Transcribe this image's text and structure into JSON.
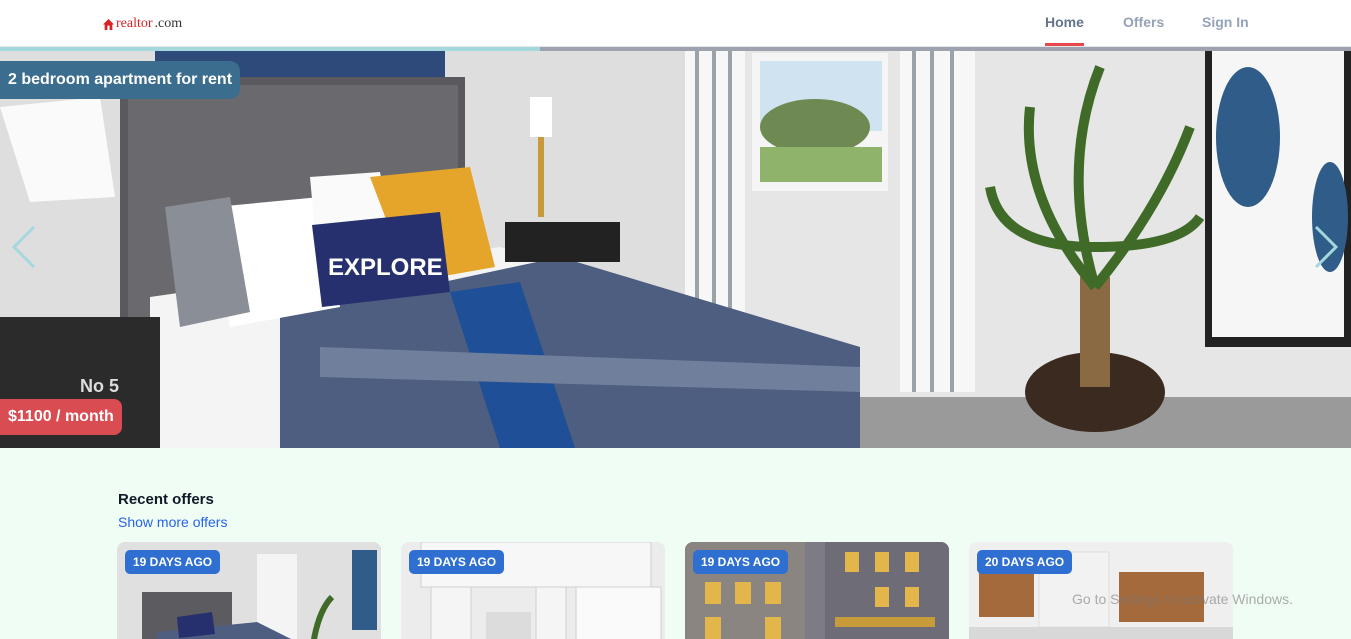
{
  "header": {
    "logo_text": "realtor",
    "logo_tld": ".com",
    "nav": [
      {
        "label": "Home",
        "active": true
      },
      {
        "label": "Offers",
        "active": false
      },
      {
        "label": "Sign In",
        "active": false
      }
    ]
  },
  "hero": {
    "title": "2 bedroom apartment for rent",
    "price": "$1100 / month",
    "slide_progress": 0.4,
    "prev_icon": "chevron-left-icon",
    "next_icon": "chevron-right-icon",
    "pillow_text": "EXPLORE"
  },
  "offers": {
    "title": "Recent offers",
    "more_link": "Show more offers",
    "cards": [
      {
        "badge": "19 DAYS AGO"
      },
      {
        "badge": "19 DAYS AGO"
      },
      {
        "badge": "19 DAYS AGO"
      },
      {
        "badge": "20 DAYS AGO"
      }
    ]
  },
  "watermark": "Go to Settings to activate Windows.",
  "colors": {
    "accent": "#e8474d",
    "title_pill": "#3b6d8f",
    "price_pill": "#d94c51",
    "badge": "#2f6fd1",
    "link": "#2563eb",
    "page_bg": "#f0fdf4"
  }
}
